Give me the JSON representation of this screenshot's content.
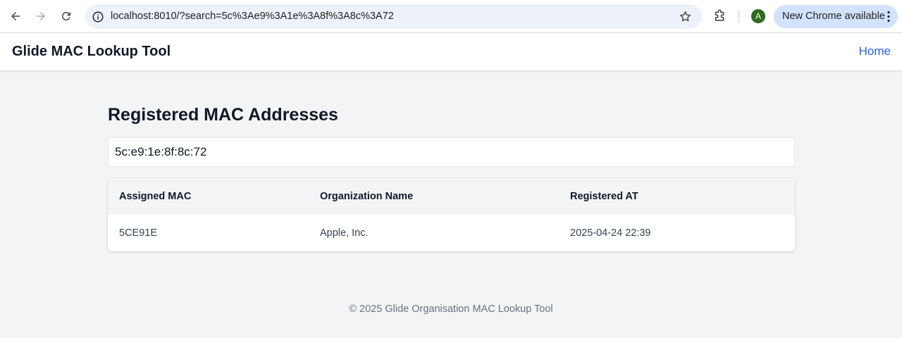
{
  "browser": {
    "url": "localhost:8010/?search=5c%3Ae9%3A1e%3A8f%3A8c%3A72",
    "profile_initial": "A",
    "update_label": "New Chrome available"
  },
  "header": {
    "title": "Glide MAC Lookup Tool",
    "home_link": "Home"
  },
  "main": {
    "heading": "Registered MAC Addresses",
    "search_value": "5c:e9:1e:8f:8c:72",
    "table": {
      "columns": [
        "Assigned MAC",
        "Organization Name",
        "Registered AT"
      ],
      "rows": [
        {
          "assigned_mac": "5CE91E",
          "organization": "Apple, Inc.",
          "registered_at": "2025-04-24 22:39"
        }
      ]
    }
  },
  "footer": {
    "text": "© 2025 Glide Organisation MAC Lookup Tool"
  },
  "colors": {
    "accent": "#2563eb",
    "background": "#f3f4f6",
    "profile": "#2e6b1f",
    "update_pill": "#d3e3fd"
  }
}
